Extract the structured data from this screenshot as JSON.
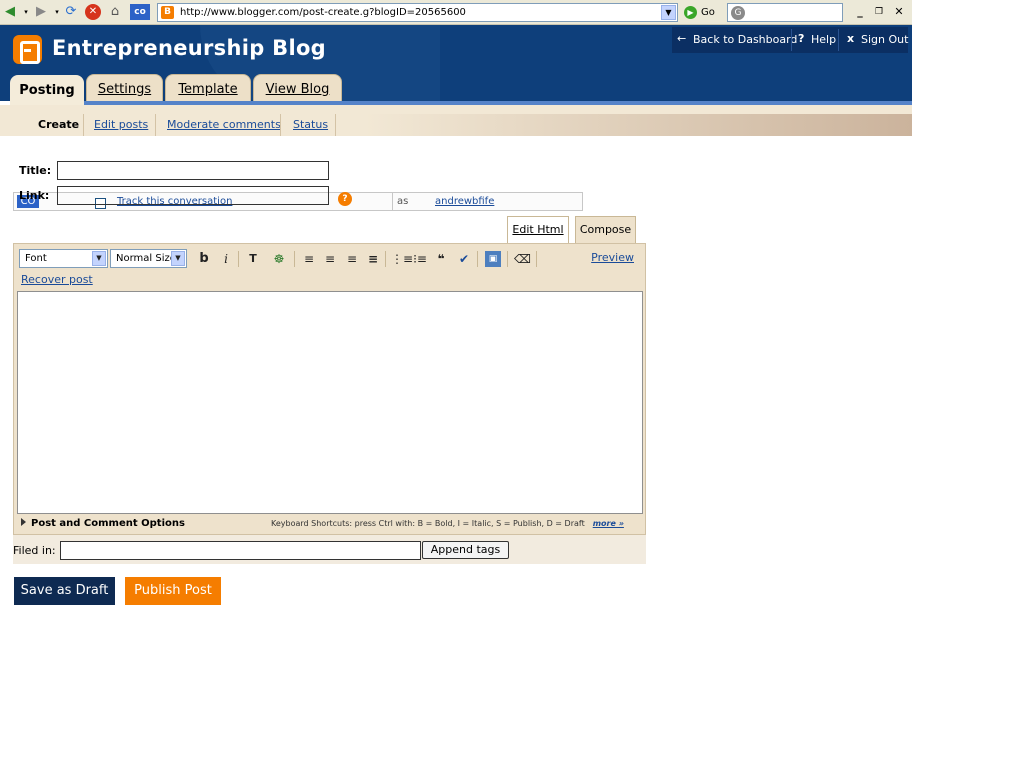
{
  "browser": {
    "url": "http://www.blogger.com/post-create.g?blogID=20565600",
    "go_label": "Go",
    "favicon_letter": "B",
    "search_logo": "G"
  },
  "header": {
    "blog_title": "Entrepreneurship Blog",
    "links": {
      "dashboard": "Back to Dashboard",
      "help": "Help",
      "signout": "Sign Out"
    }
  },
  "tabs": [
    "Posting",
    "Settings",
    "Template",
    "View Blog"
  ],
  "subnav": [
    "Create",
    "Edit posts",
    "Moderate comments",
    "Status"
  ],
  "form": {
    "title_label": "Title:",
    "link_label": "Link:",
    "title_value": "",
    "link_value": ""
  },
  "overlay": {
    "badge": "CO",
    "track_label": "Track this conversation",
    "as_label": "as",
    "username": "andrewbfife"
  },
  "editor": {
    "mode_tabs": [
      "Edit Html",
      "Compose"
    ],
    "font_select": "Font",
    "size_select": "Normal Size",
    "bold_glyph": "b",
    "italic_glyph": "i",
    "preview_label": "Preview",
    "recover_label": "Recover post",
    "options_label": "Post and Comment Options",
    "shortcuts_text": "Keyboard Shortcuts: press Ctrl with: B = Bold, I = Italic, S = Publish, D = Draft",
    "more_label": "more »"
  },
  "tags": {
    "label": "Filed in:",
    "value": "",
    "append_label": "Append tags"
  },
  "actions": {
    "draft_label": "Save as Draft",
    "publish_label": "Publish Post"
  },
  "colors": {
    "header_blue": "#0e3f7b",
    "blogger_orange": "#f57d00",
    "draft_button": "#0e2a52",
    "publish_button": "#f57d00"
  }
}
